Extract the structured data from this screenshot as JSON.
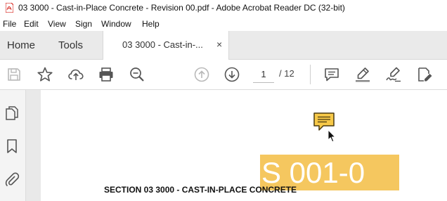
{
  "window": {
    "title": "03 3000 - Cast-in-Place Concrete - Revision 00.pdf - Adobe Acrobat Reader DC (32-bit)"
  },
  "menu": [
    "File",
    "Edit",
    "View",
    "Sign",
    "Window",
    "Help"
  ],
  "tabs": {
    "home": "Home",
    "tools": "Tools",
    "document": "03 3000 - Cast-in-...",
    "close_glyph": "×"
  },
  "toolbar": {
    "icons": [
      "save-icon",
      "bookmark-star-icon",
      "cloud-upload-icon",
      "print-icon",
      "zoom-icon",
      "page-up-icon",
      "page-down-icon",
      "comment-icon",
      "highlight-icon",
      "sign-icon",
      "edit-pdf-icon"
    ],
    "current_page": "1",
    "page_total": "/ 12"
  },
  "sidebar": {
    "icons": [
      "pages-icon",
      "bookmarks-icon",
      "attachments-icon"
    ]
  },
  "document": {
    "stamp_text": "S 001-0",
    "section_heading": "SECTION 03 3000 - CAST-IN-PLACE CONCRETE"
  },
  "colors": {
    "stamp": "#f5c75f",
    "note": "#f7c948",
    "app_icon": "#d7261e"
  }
}
